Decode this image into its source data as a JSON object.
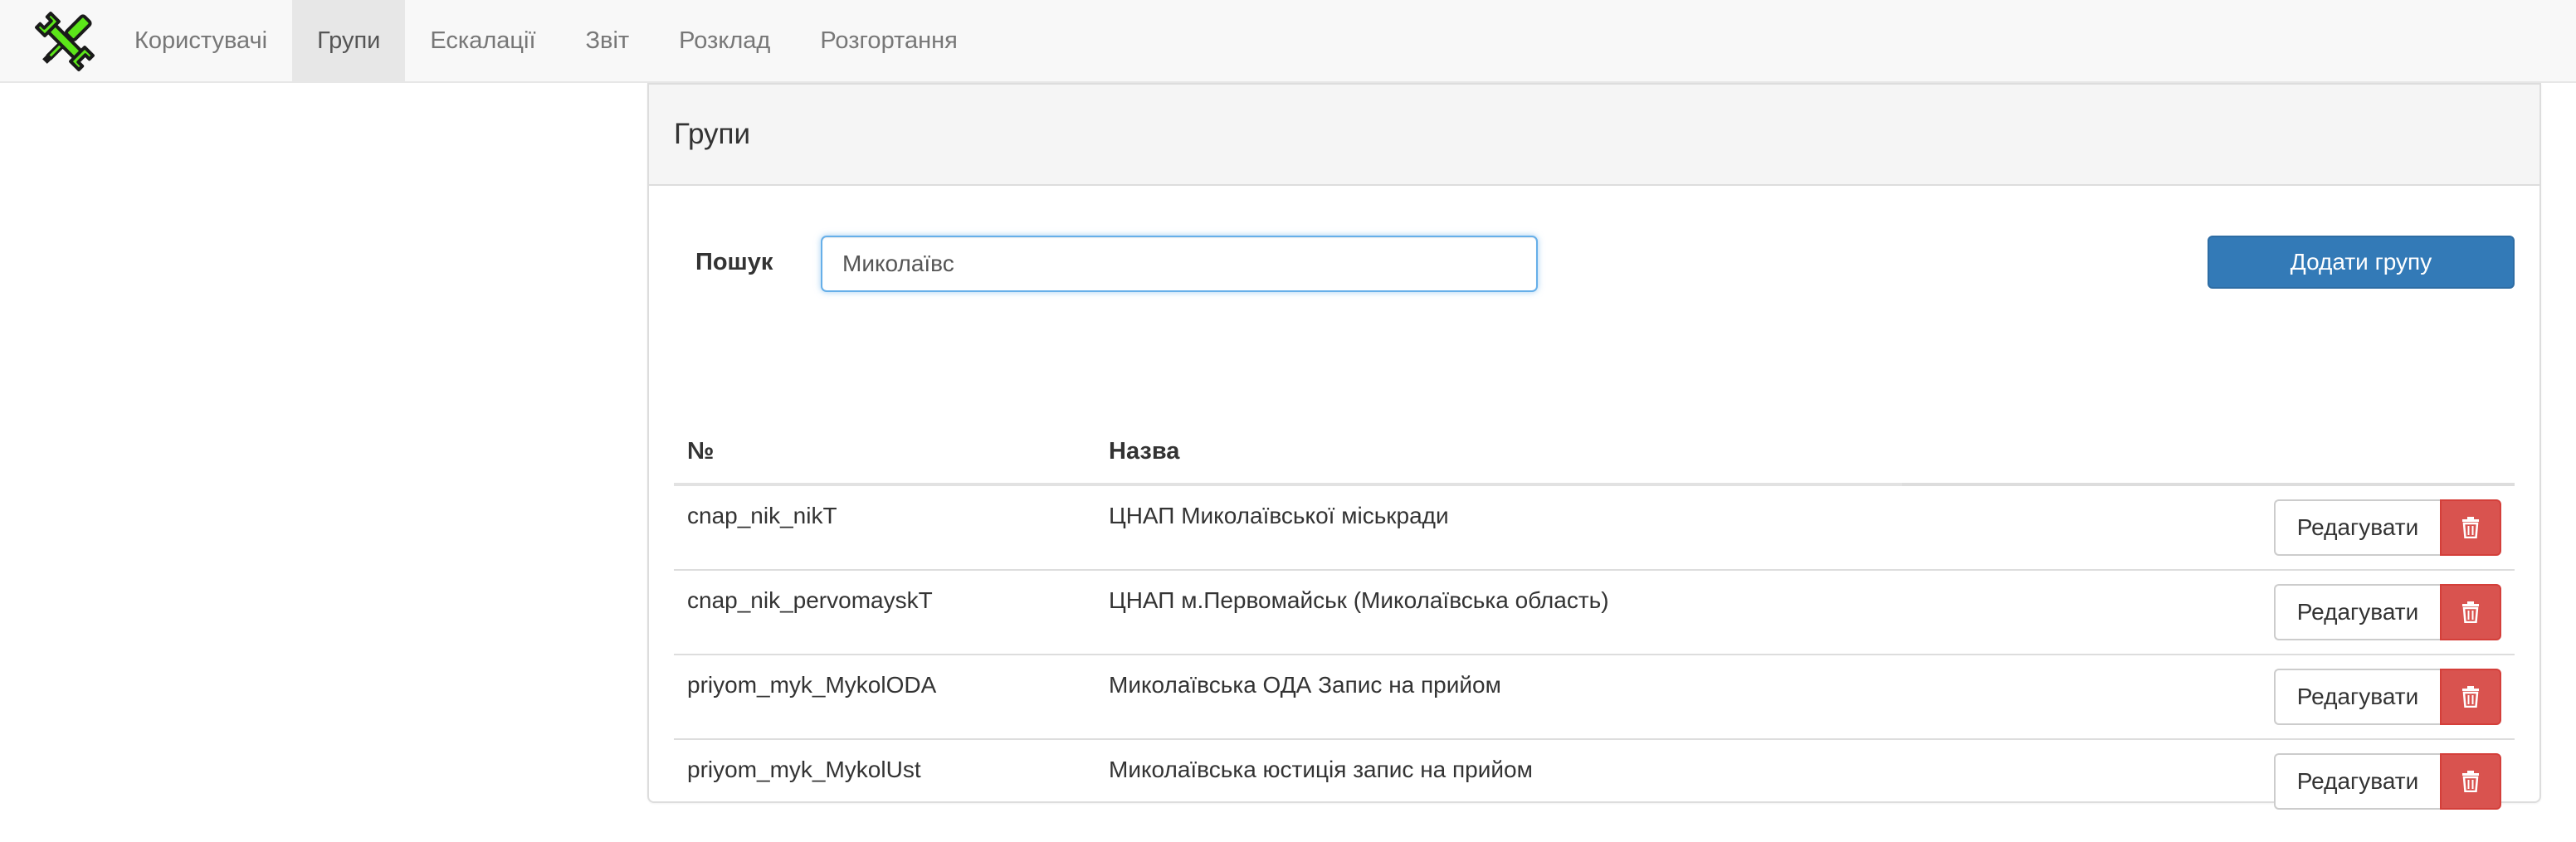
{
  "nav": {
    "logo_icon": "wrench-screwdriver-icon",
    "items": [
      {
        "label": "Користувачі",
        "active": false
      },
      {
        "label": "Групи",
        "active": true
      },
      {
        "label": "Ескалації",
        "active": false
      },
      {
        "label": "Звіт",
        "active": false
      },
      {
        "label": "Розклад",
        "active": false
      },
      {
        "label": "Розгортання",
        "active": false
      }
    ]
  },
  "panel": {
    "title": "Групи"
  },
  "search": {
    "label": "Пошук",
    "value": "Миколаївс"
  },
  "add_button": {
    "label": "Додати групу"
  },
  "table": {
    "columns": [
      "№",
      "Назва"
    ],
    "rows": [
      {
        "id": "cnap_nik_nikT",
        "name": "ЦНАП Миколаївської міськради",
        "edit_label": "Редагувати",
        "delete_icon": "trash-icon"
      },
      {
        "id": "cnap_nik_pervomayskT",
        "name": "ЦНАП м.Первомайськ (Миколаївська область)",
        "edit_label": "Редагувати",
        "delete_icon": "trash-icon"
      },
      {
        "id": "priyom_myk_MykolODA",
        "name": "Миколаївська ОДА Запис на прийом",
        "edit_label": "Редагувати",
        "delete_icon": "trash-icon"
      },
      {
        "id": "priyom_myk_MykolUst",
        "name": "Миколаївська юстиція запис на прийом",
        "edit_label": "Редагувати",
        "delete_icon": "trash-icon"
      }
    ]
  },
  "colors": {
    "primary": "#337ab7",
    "danger": "#d9534f",
    "logo_green": "#5ce619",
    "focus_border": "#66afe9"
  }
}
